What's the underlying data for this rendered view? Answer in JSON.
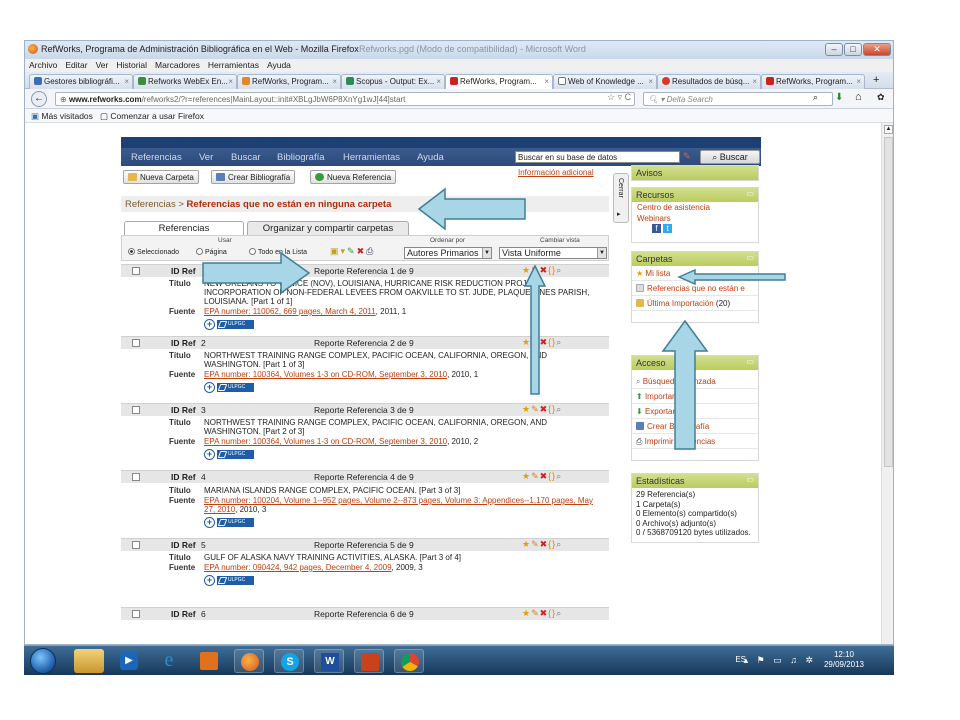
{
  "window": {
    "title": "RefWorks, Programa de Administración Bibliográfica en el Web - Mozilla Firefox",
    "title_ghost": "Refworks.pgd (Modo de compatibilidad) - Microsoft Word"
  },
  "menubar": [
    "Archivo",
    "Editar",
    "Ver",
    "Historial",
    "Marcadores",
    "Herramientas",
    "Ayuda"
  ],
  "browser_tabs": [
    {
      "label": "Gestores bibliográfi...",
      "color": "#3a6fb0"
    },
    {
      "label": "Refworks WebEx En...",
      "color": "#3b8f3b"
    },
    {
      "label": "RefWorks, Program...",
      "color": "#e0872a"
    },
    {
      "label": "Scopus - Output: Ex...",
      "color": "#2e8b57"
    },
    {
      "label": "RefWorks, Program...",
      "color": "#c8231f"
    },
    {
      "label": "Web of Knowledge ...",
      "color": "#7a7a7a"
    },
    {
      "label": "Resultados de búsq...",
      "color": "#d33a2a"
    },
    {
      "label": "RefWorks, Program...",
      "color": "#c8231f"
    }
  ],
  "url": {
    "domain": "www.refworks.com",
    "path": "/refworks2/?r=references|MainLayout::init#XBLgJbW6P8XnYg1wJ[44]start"
  },
  "browser_search_placeholder": "Delta Search",
  "bookmarks": [
    "Más visitados",
    "Comenzar a usar Firefox"
  ],
  "app_nav": [
    "Referencias",
    "Ver",
    "Buscar",
    "Bibliografía",
    "Herramientas",
    "Ayuda"
  ],
  "page_search": {
    "value": "Buscar en su base de datos",
    "button": "Buscar"
  },
  "buttons": {
    "new_folder": "Nueva Carpeta",
    "create_bib": "Crear Bibliografía",
    "new_ref": "Nueva Referencia"
  },
  "info_link": "Información adicional",
  "breadcrumb": {
    "root": "Referencias",
    "sep": ">",
    "current": "Referencias que no están en ninguna carpeta"
  },
  "tabs": [
    "Referencias",
    "Organizar y compartir carpetas"
  ],
  "toolstrip": {
    "usar_label": "Usar",
    "radios": [
      "Seleccionado",
      "Página",
      "Todo en la Lista"
    ],
    "sort_label": "Ordenar por",
    "sort_value": "Autores Primarios",
    "view_label": "Cambiar vista",
    "view_value": "Vista Uniforme"
  },
  "record_labels": {
    "id": "ID Ref",
    "title": "Título",
    "source": "Fuente"
  },
  "records": [
    {
      "id": "",
      "report": "Reporte Referencia 1 de 9",
      "title": "NEW ORLEANS TO VENICE (NOV), LOUISIANA, HURRICANE RISK REDUCTION PROJECT, INCORPORATION OF NON-FEDERAL LEVEES FROM OAKVILLE TO ST. JUDE, PLAQUEMINES PARISH, LOUISIANA. [Part 1 of 1]",
      "source_link": "EPA number: 110062, 669 pages, March 4, 2011",
      "source_rest": ", 2011, 1"
    },
    {
      "id": "2",
      "report": "Reporte Referencia 2 de 9",
      "title": "NORTHWEST TRAINING RANGE COMPLEX, PACIFIC OCEAN, CALIFORNIA, OREGON, AND WASHINGTON. [Part 1 of 3]",
      "source_link": "EPA number: 100364, Volumes 1-3 on CD-ROM, September 3, 2010",
      "source_rest": ", 2010, 1"
    },
    {
      "id": "3",
      "report": "Reporte Referencia 3 de 9",
      "title": "NORTHWEST TRAINING RANGE COMPLEX, PACIFIC OCEAN, CALIFORNIA, OREGON, AND WASHINGTON. [Part 2 of 3]",
      "source_link": "EPA number: 100364, Volumes 1-3 on CD-ROM, September 3, 2010",
      "source_rest": ", 2010, 2"
    },
    {
      "id": "4",
      "report": "Reporte Referencia 4 de 9",
      "title": "MARIANA ISLANDS RANGE COMPLEX, PACIFIC OCEAN. [Part 3 of 3]",
      "source_link": "EPA number: 100204, Volume 1--952 pages, Volume 2--873 pages, Volume 3: Appendices--1,170 pages, May 27, 2010",
      "source_rest": ", 2010, 3"
    },
    {
      "id": "5",
      "report": "Reporte Referencia 5 de 9",
      "title": "GULF OF ALASKA NAVY TRAINING ACTIVITIES, ALASKA. [Part 3 of 4]",
      "source_link": "EPA number: 090424, 942 pages, December 4, 2009",
      "source_rest": ", 2009, 3"
    },
    {
      "id": "6",
      "report": "Reporte Referencia 6 de 9",
      "title": "",
      "source_link": "",
      "source_rest": ""
    }
  ],
  "ulpgc_label": "ULPGC",
  "sidebar": {
    "handle": "Cerrar",
    "avisos": "Avisos",
    "recursos": {
      "title": "Recursos",
      "items": [
        "Centro de asistencia",
        "Webinars"
      ]
    },
    "carpetas": {
      "title": "Carpetas",
      "items": [
        {
          "label": "Mi lista",
          "count": ""
        },
        {
          "label": "Referencias que no están e",
          "count": ""
        },
        {
          "label": "Última Importación",
          "count": "(20)"
        }
      ]
    },
    "acceso": {
      "title": "Acceso",
      "items": [
        "Búsqueda avanzada",
        "Importar",
        "Exportar",
        "Crear Bibliografía",
        "Imprimir referencias"
      ]
    },
    "estadisticas": {
      "title": "Estadísticas",
      "lines": [
        "29 Referencia(s)",
        "1 Carpeta(s)",
        "0 Elemento(s) compartido(s)",
        "0 Archivo(s) adjunto(s)",
        "0 / 5368709120 bytes utilizados."
      ]
    }
  },
  "taskbar": {
    "lang": "ES",
    "time": "12:10",
    "date": "29/09/2013"
  },
  "colors": {
    "nav": "#2c4a7a",
    "accent_link": "#c04010",
    "sidebar_header": "#c5d577",
    "annotation_arrow": "#a9d6e6"
  }
}
